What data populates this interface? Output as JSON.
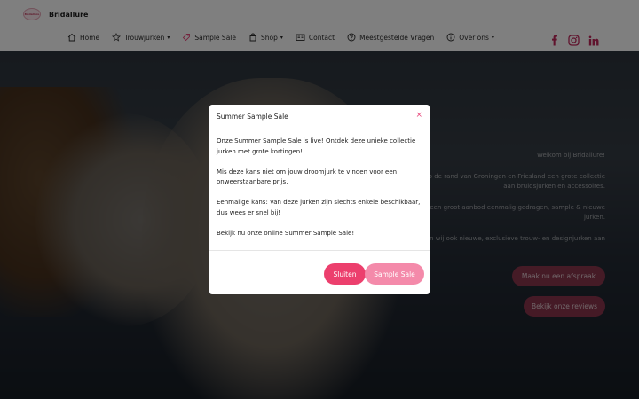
{
  "header": {
    "brand_name": "Bridallure",
    "logo_text": "Bridallure",
    "nav": [
      {
        "label": "Home",
        "icon": "home-icon"
      },
      {
        "label": "Trouwjurken",
        "icon": "star-icon",
        "dropdown": true
      },
      {
        "label": "Sample Sale",
        "icon": "tag-icon"
      },
      {
        "label": "Shop",
        "icon": "shopping-bag-icon",
        "dropdown": true
      },
      {
        "label": "Contact",
        "icon": "contact-card-icon"
      },
      {
        "label": "Meestgestelde Vragen",
        "icon": "question-icon"
      },
      {
        "label": "Over ons",
        "icon": "info-icon",
        "dropdown": true
      }
    ],
    "socials": [
      "facebook-icon",
      "instagram-icon",
      "linkedin-icon"
    ]
  },
  "hero": {
    "paragraphs": [
      "Welkom bij Bridallure!",
      "Bridallure biedt op de rand van Groningen en Friesland een grote collectie aan bruidsjurken en accessoires.",
      "We hebben een groot aanbod eenmalig gedragen, sample & nieuwe jurken.",
      "Daarnaast bieden wij ook nieuwe, exclusieve trouw- en designjurken aan"
    ],
    "appointment_button": "Maak nu een afspraak",
    "reviews_button": "Bekijk onze reviews"
  },
  "modal": {
    "title": "Summer Sample Sale",
    "close_symbol": "×",
    "paragraphs": [
      "Onze Summer Sample Sale is live! Ontdek deze unieke collectie jurken met grote kortingen!",
      "Mis deze kans niet om jouw droomjurk te vinden voor een onweerstaanbare prijs.",
      "Eenmalige kans: Van deze jurken zijn slechts enkele beschikbaar, dus wees er snel bij!",
      "Bekijk nu onze online Summer Sample Sale!"
    ],
    "close_button": "Sluiten",
    "sample_sale_button": "Sample Sale"
  },
  "colors": {
    "accent": "#ec3f6d",
    "accent_light": "#f48aaa",
    "social": "#c0265a",
    "hero_button": "#963750"
  },
  "caret": "▾"
}
